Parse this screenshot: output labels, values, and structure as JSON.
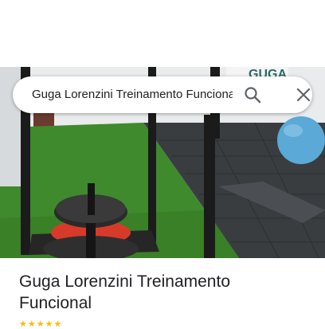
{
  "search": {
    "query": "Guga Lorenzini Treinamento Funcional"
  },
  "photo": {
    "sign_text": "GUGA"
  },
  "place": {
    "title": "Guga Lorenzini Treinamento Funcional",
    "stars": "★★★★★"
  },
  "colors": {
    "turf": "#3f8a2c",
    "rubber_floor": "#3a3d40",
    "exercise_ball": "#5aa9d6",
    "weight_plate_red": "#d83a2a",
    "star": "#fbbc04"
  },
  "icons": [
    "search-icon",
    "close-icon"
  ]
}
